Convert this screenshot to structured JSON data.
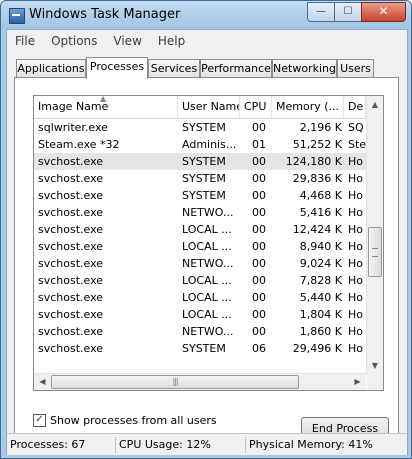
{
  "window": {
    "title": "Windows Task Manager"
  },
  "caption": {
    "minimize": "—",
    "maximize": "☐",
    "close": "✕"
  },
  "menu": [
    "File",
    "Options",
    "View",
    "Help"
  ],
  "tabs": [
    "Applications",
    "Processes",
    "Services",
    "Performance",
    "Networking",
    "Users"
  ],
  "active_tab": "Processes",
  "columns": [
    "Image Name",
    "User Name",
    "CPU",
    "Memory (...",
    "De"
  ],
  "sort": {
    "column": "Image Name",
    "icon": "sort-ascending-icon"
  },
  "processes": [
    [
      "sqlwriter.exe",
      "SYSTEM",
      "00",
      "2,196 K",
      "SQ"
    ],
    [
      "Steam.exe *32",
      "Adminis...",
      "01",
      "51,252 K",
      "Ste"
    ],
    [
      "svchost.exe",
      "SYSTEM",
      "00",
      "124,180 K",
      "Ho"
    ],
    [
      "svchost.exe",
      "SYSTEM",
      "00",
      "29,836 K",
      "Ho"
    ],
    [
      "svchost.exe",
      "SYSTEM",
      "00",
      "4,468 K",
      "Ho"
    ],
    [
      "svchost.exe",
      "NETWO...",
      "00",
      "5,416 K",
      "Ho"
    ],
    [
      "svchost.exe",
      "LOCAL ...",
      "00",
      "12,424 K",
      "Ho"
    ],
    [
      "svchost.exe",
      "LOCAL ...",
      "00",
      "8,940 K",
      "Ho"
    ],
    [
      "svchost.exe",
      "NETWO...",
      "00",
      "9,024 K",
      "Ho"
    ],
    [
      "svchost.exe",
      "LOCAL ...",
      "00",
      "7,828 K",
      "Ho"
    ],
    [
      "svchost.exe",
      "LOCAL ...",
      "00",
      "5,440 K",
      "Ho"
    ],
    [
      "svchost.exe",
      "LOCAL ...",
      "00",
      "1,804 K",
      "Ho"
    ],
    [
      "svchost.exe",
      "NETWO...",
      "00",
      "1,860 K",
      "Ho"
    ],
    [
      "svchost.exe",
      "SYSTEM",
      "06",
      "29,496 K",
      "Ho"
    ]
  ],
  "selected_row": 2,
  "show_all": {
    "label": "Show processes from all users",
    "checked": true
  },
  "end_process": "End Process",
  "status": {
    "processes": "Processes: 67",
    "cpu": "CPU Usage: 12%",
    "memory": "Physical Memory: 41%"
  }
}
